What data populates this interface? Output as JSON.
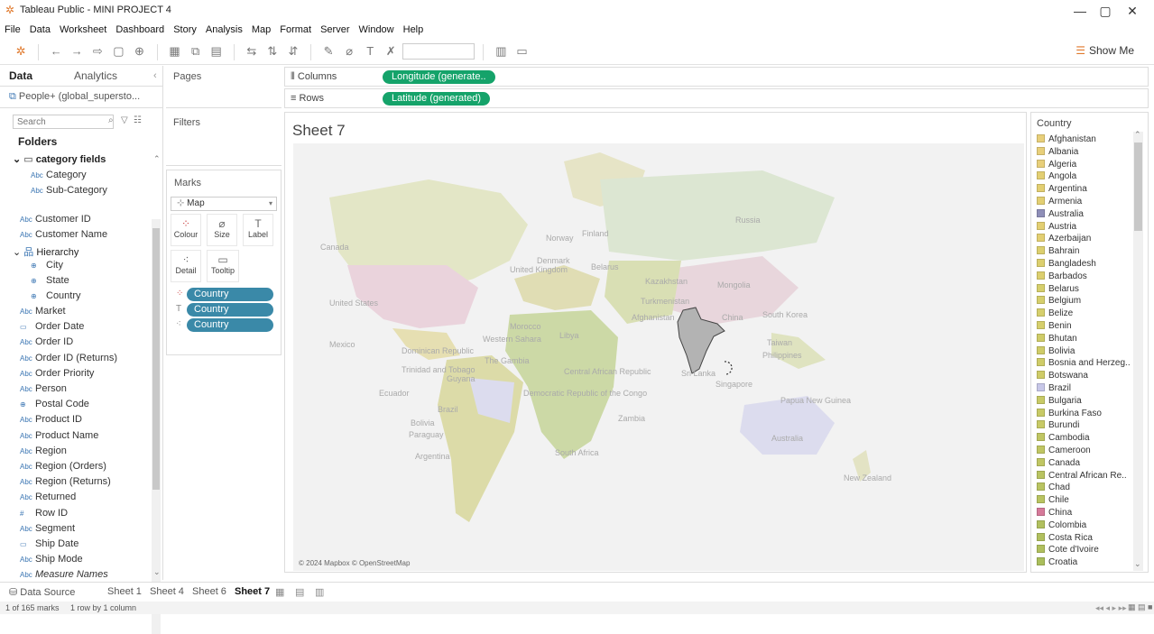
{
  "window": {
    "title": "Tableau Public - MINI PROJECT 4"
  },
  "menu": [
    "File",
    "Data",
    "Worksheet",
    "Dashboard",
    "Story",
    "Analysis",
    "Map",
    "Format",
    "Server",
    "Window",
    "Help"
  ],
  "toolbar": {
    "show_me": "Show Me"
  },
  "data_pane": {
    "tab_data": "Data",
    "tab_analytics": "Analytics",
    "datasource": "People+ (global_supersto...",
    "search_placeholder": "Search",
    "folders_label": "Folders",
    "category_folder": "category fields",
    "category_items": [
      "Category",
      "Sub-Category"
    ],
    "fields_a": [
      "Customer ID",
      "Customer Name"
    ],
    "hierarchy": "Hierarchy",
    "hierarchy_items": [
      "City",
      "State",
      "Country"
    ],
    "fields_b": [
      "Market",
      "Order Date",
      "Order ID",
      "Order ID (Returns)",
      "Order Priority",
      "Person",
      "Postal Code",
      "Product ID",
      "Product Name",
      "Region",
      "Region (Orders)",
      "Region (Returns)",
      "Returned",
      "Row ID",
      "Segment",
      "Ship Date",
      "Ship Mode",
      "Measure Names"
    ]
  },
  "cards": {
    "pages": "Pages",
    "filters": "Filters",
    "marks": "Marks",
    "mark_type": "Map",
    "mark_buttons": [
      "Colour",
      "Size",
      "Label",
      "Detail",
      "Tooltip"
    ],
    "mark_pills": [
      "Country",
      "Country",
      "Country"
    ]
  },
  "shelves": {
    "columns_label": "Columns",
    "columns_pill": "Longitude (generate..",
    "rows_label": "Rows",
    "rows_pill": "Latitude (generated)"
  },
  "sheet": {
    "title": "Sheet 7",
    "attribution": "© 2024 Mapbox © OpenStreetMap",
    "map_labels": [
      "Russia",
      "Canada",
      "Norway",
      "Finland",
      "Denmark",
      "United Kingdom",
      "Belarus",
      "Kazakhstan",
      "Mongolia",
      "United States",
      "Turkmenistan",
      "China",
      "South Korea",
      "Morocco",
      "Afghanistan",
      "Mexico",
      "Western Sahara",
      "Libya",
      "Taiwan",
      "Dominican Republic",
      "Philippines",
      "The Gambia",
      "Trinidad and Tobago",
      "Guyana",
      "Sri Lanka",
      "Central African Republic",
      "Singapore",
      "Ecuador",
      "Democratic Republic of the Congo",
      "Papua New Guinea",
      "Brazil",
      "Bolivia",
      "Zambia",
      "Paraguay",
      "Australia",
      "South Africa",
      "Argentina",
      "New Zealand"
    ]
  },
  "legend": {
    "title": "Country",
    "items": [
      {
        "name": "Afghanistan",
        "color": "#e8cf7a"
      },
      {
        "name": "Albania",
        "color": "#e8cf7a"
      },
      {
        "name": "Algeria",
        "color": "#e8cf7a"
      },
      {
        "name": "Angola",
        "color": "#e3cf72"
      },
      {
        "name": "Argentina",
        "color": "#e3cf72"
      },
      {
        "name": "Armenia",
        "color": "#e3cf72"
      },
      {
        "name": "Australia",
        "color": "#8f8fb8"
      },
      {
        "name": "Austria",
        "color": "#e3cf72"
      },
      {
        "name": "Azerbaijan",
        "color": "#e3cf72"
      },
      {
        "name": "Bahrain",
        "color": "#dccf6e"
      },
      {
        "name": "Bangladesh",
        "color": "#dccf6e"
      },
      {
        "name": "Barbados",
        "color": "#dccf6e"
      },
      {
        "name": "Belarus",
        "color": "#d6cf6c"
      },
      {
        "name": "Belgium",
        "color": "#d6cf6c"
      },
      {
        "name": "Belize",
        "color": "#d6cf6c"
      },
      {
        "name": "Benin",
        "color": "#d6cf6c"
      },
      {
        "name": "Bhutan",
        "color": "#cfcc68"
      },
      {
        "name": "Bolivia",
        "color": "#cfcc68"
      },
      {
        "name": "Bosnia and Herzeg..",
        "color": "#cfcc68"
      },
      {
        "name": "Botswana",
        "color": "#cfcc68"
      },
      {
        "name": "Brazil",
        "color": "#c7c7e8"
      },
      {
        "name": "Bulgaria",
        "color": "#c8ca66"
      },
      {
        "name": "Burkina Faso",
        "color": "#c8ca66"
      },
      {
        "name": "Burundi",
        "color": "#c8ca66"
      },
      {
        "name": "Cambodia",
        "color": "#c0c663"
      },
      {
        "name": "Cameroon",
        "color": "#c0c663"
      },
      {
        "name": "Canada",
        "color": "#c0c663"
      },
      {
        "name": "Central African Re..",
        "color": "#b9c461"
      },
      {
        "name": "Chad",
        "color": "#b9c461"
      },
      {
        "name": "Chile",
        "color": "#b9c461"
      },
      {
        "name": "China",
        "color": "#d67a9a"
      },
      {
        "name": "Colombia",
        "color": "#b1c05e"
      },
      {
        "name": "Costa Rica",
        "color": "#b1c05e"
      },
      {
        "name": "Cote d'Ivoire",
        "color": "#b1c05e"
      },
      {
        "name": "Croatia",
        "color": "#aabe5b"
      }
    ]
  },
  "tabs": {
    "data_source": "Data Source",
    "sheets": [
      "Sheet 1",
      "Sheet 4",
      "Sheet 6",
      "Sheet 7"
    ]
  },
  "status": {
    "marks": "1 of 165 marks",
    "dims": "1 row by 1 column"
  }
}
